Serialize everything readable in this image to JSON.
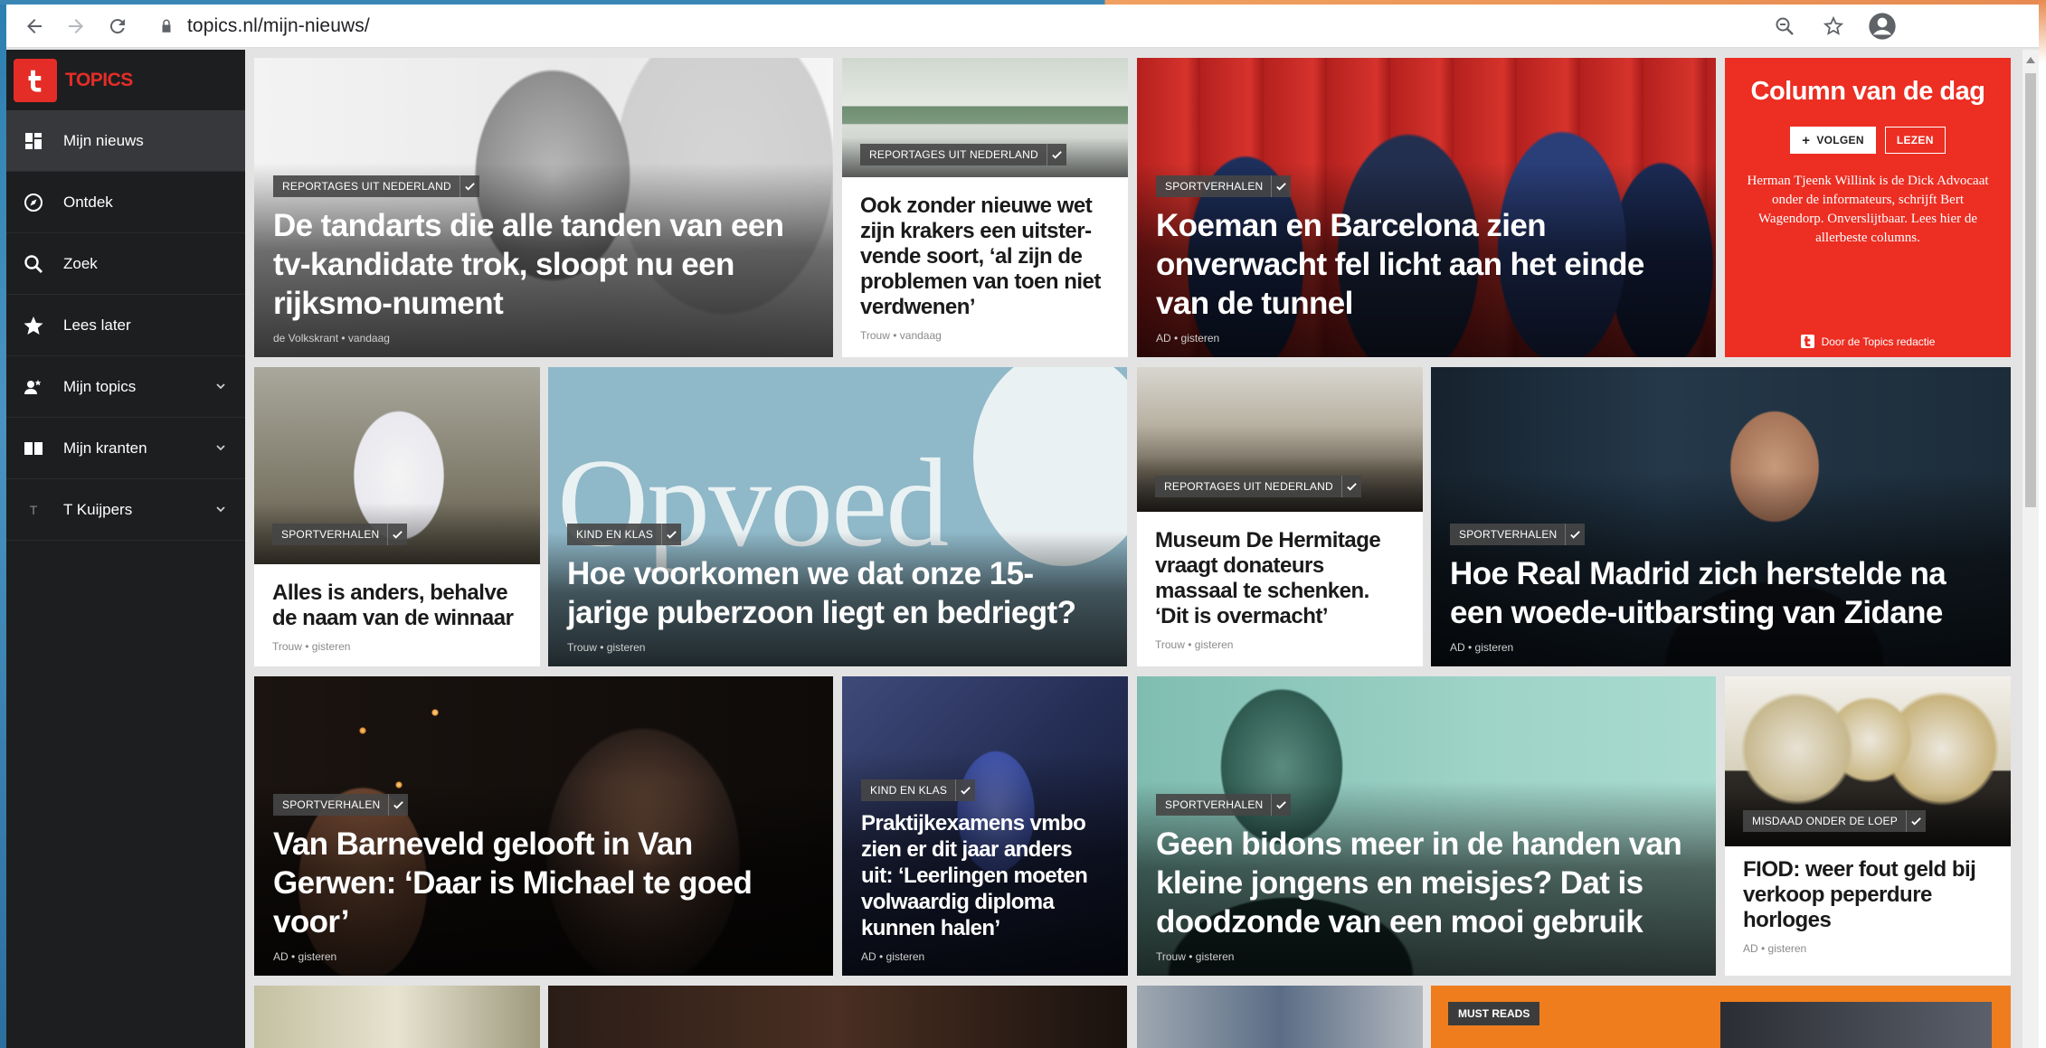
{
  "browser": {
    "url": "topics.nl/mijn-nieuws/"
  },
  "sidebar": {
    "logo_text": "TOPICS",
    "items": [
      {
        "label": "Mijn nieuws",
        "icon": "dashboard-icon",
        "active": true
      },
      {
        "label": "Ontdek",
        "icon": "compass-icon"
      },
      {
        "label": "Zoek",
        "icon": "search-icon"
      },
      {
        "label": "Lees later",
        "icon": "star-icon"
      },
      {
        "label": "Mijn topics",
        "icon": "user-topics-icon",
        "expandable": true
      },
      {
        "label": "Mijn kranten",
        "icon": "newspapers-icon",
        "expandable": true
      },
      {
        "label": "T Kuijpers",
        "icon": "avatar-icon",
        "avatar_letter": "T",
        "expandable": true
      }
    ]
  },
  "cards": [
    {
      "tag": "Reportages uit Nederland",
      "title": "De tandarts die alle tanden van een tv-kandidate trok, sloopt nu een rijksmo-nument",
      "meta": "de Volkskrant • vandaag"
    },
    {
      "tag": "Reportages uit Nederland",
      "title": "Ook zonder nieuwe wet zijn krakers een uitster-vende soort, ‘al zijn de problemen van toen niet verdwenen’",
      "meta": "Trouw • vandaag"
    },
    {
      "tag": "Sportverhalen",
      "title": "Koeman en Barcelona zien onverwacht fel licht aan het einde van de tunnel",
      "meta": "AD • gisteren"
    },
    {
      "tag": "Sportverhalen",
      "title": "Alles is anders, behalve de naam van de winnaar",
      "meta": "Trouw • gisteren"
    },
    {
      "tag": "Kind en klas",
      "title": "Hoe voorkomen we dat onze 15-jarige puberzoon liegt en bedriegt?",
      "meta": "Trouw • gisteren",
      "image_text": "Opvoed"
    },
    {
      "tag": "Reportages uit Nederland",
      "title": "Museum De Hermitage vraagt donateurs massaal te schenken. ‘Dit is overmacht’",
      "meta": "Trouw • gisteren"
    },
    {
      "tag": "Sportverhalen",
      "title": "Hoe Real Madrid zich herstelde na een woede-uitbarsting van Zidane",
      "meta": "AD • gisteren"
    },
    {
      "tag": "Sportverhalen",
      "title": "Van Barneveld gelooft in Van Gerwen: ‘Daar is Michael te goed voor’",
      "meta": "AD • gisteren"
    },
    {
      "tag": "Kind en klas",
      "title": "Praktijkexamens vmbo zien er dit jaar anders uit: ‘Leerlingen moeten volwaardig diploma kunnen halen’",
      "meta": "AD • gisteren"
    },
    {
      "tag": "Sportverhalen",
      "title": "Geen bidons meer in de handen van kleine jongens en meisjes? Dat is doodzonde van een mooi gebruik",
      "meta": "Trouw • gisteren"
    },
    {
      "tag": "Misdaad onder de loep",
      "title": "FIOD: weer fout geld bij verkoop peperdure horloges",
      "meta": "AD • gisteren"
    }
  ],
  "column": {
    "title": "Column van de dag",
    "follow_label": "VOLGEN",
    "read_label": "LEZEN",
    "body": "Herman Tjeenk Willink is de Dick Advocaat onder de informateurs, schrijft Bert Wagendorp. Onverslijtbaar. Lees hier de allerbeste columns.",
    "footer": "Door de Topics redactie"
  },
  "must_reads": {
    "tag": "MUST READS"
  },
  "colors": {
    "brand": "#e52d27",
    "sidebar": "#1d1e20",
    "must_reads": "#ef7d1d"
  }
}
